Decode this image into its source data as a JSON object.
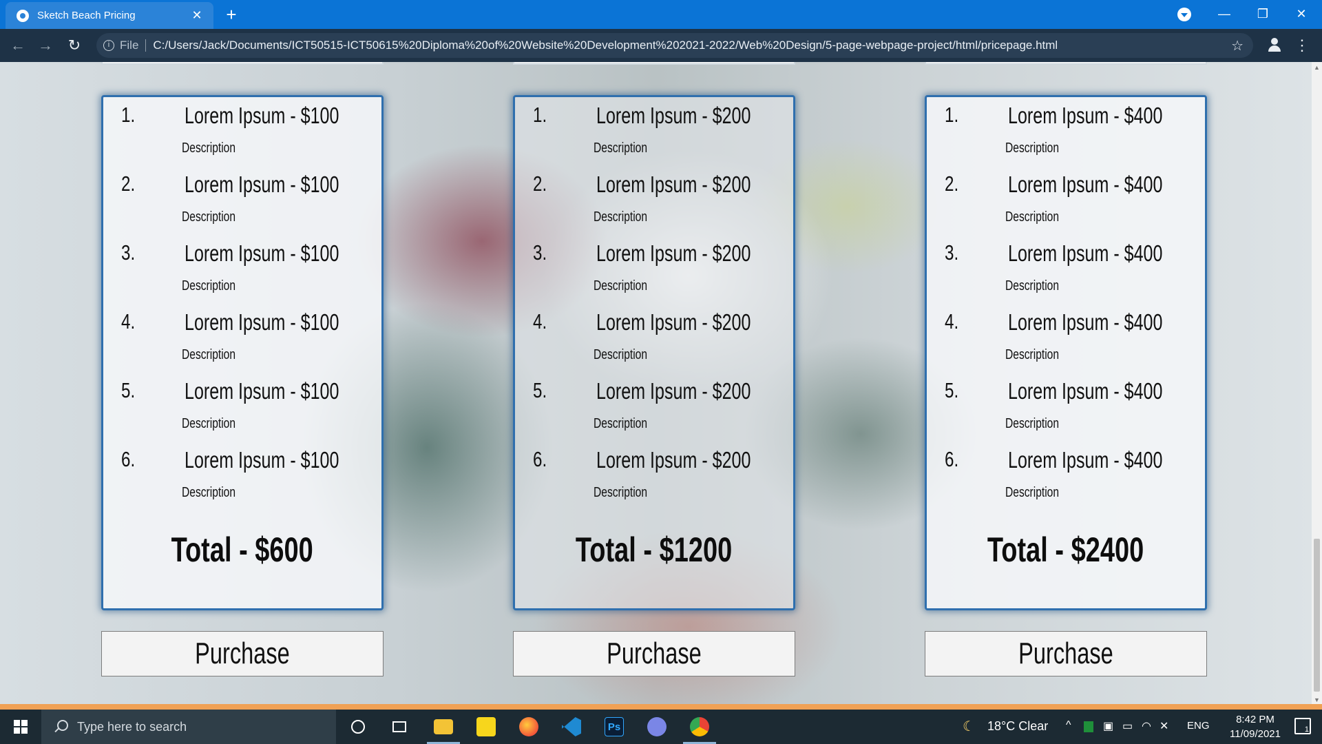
{
  "browser": {
    "tab_title": "Sketch Beach Pricing",
    "tab_close": "✕",
    "new_tab": "+",
    "window": {
      "minimize": "—",
      "maximize": "❐",
      "close": "✕"
    },
    "nav": {
      "back": "←",
      "forward": "→",
      "reload": "↻"
    },
    "address": {
      "info": "i",
      "scheme": "File",
      "url": "C:/Users/Jack/Documents/ICT50515-ICT50615%20Diploma%20of%20Website%20Development%202021-2022/Web%20Design/5-page-webpage-project/html/pricepage.html",
      "star": "☆"
    },
    "menu": "⋮"
  },
  "pricing": {
    "cards": [
      {
        "items": [
          {
            "num": "1.",
            "title": "Lorem Ipsum - $100",
            "desc": "Description"
          },
          {
            "num": "2.",
            "title": "Lorem Ipsum - $100",
            "desc": "Description"
          },
          {
            "num": "3.",
            "title": "Lorem Ipsum - $100",
            "desc": "Description"
          },
          {
            "num": "4.",
            "title": "Lorem Ipsum - $100",
            "desc": "Description"
          },
          {
            "num": "5.",
            "title": "Lorem Ipsum - $100",
            "desc": "Description"
          },
          {
            "num": "6.",
            "title": "Lorem Ipsum - $100",
            "desc": "Description"
          }
        ],
        "total": "Total - $600",
        "button": "Purchase"
      },
      {
        "items": [
          {
            "num": "1.",
            "title": "Lorem Ipsum - $200",
            "desc": "Description"
          },
          {
            "num": "2.",
            "title": "Lorem Ipsum - $200",
            "desc": "Description"
          },
          {
            "num": "3.",
            "title": "Lorem Ipsum - $200",
            "desc": "Description"
          },
          {
            "num": "4.",
            "title": "Lorem Ipsum - $200",
            "desc": "Description"
          },
          {
            "num": "5.",
            "title": "Lorem Ipsum - $200",
            "desc": "Description"
          },
          {
            "num": "6.",
            "title": "Lorem Ipsum - $200",
            "desc": "Description"
          }
        ],
        "total": "Total - $1200",
        "button": "Purchase"
      },
      {
        "items": [
          {
            "num": "1.",
            "title": "Lorem Ipsum - $400",
            "desc": "Description"
          },
          {
            "num": "2.",
            "title": "Lorem Ipsum - $400",
            "desc": "Description"
          },
          {
            "num": "3.",
            "title": "Lorem Ipsum - $400",
            "desc": "Description"
          },
          {
            "num": "4.",
            "title": "Lorem Ipsum - $400",
            "desc": "Description"
          },
          {
            "num": "5.",
            "title": "Lorem Ipsum - $400",
            "desc": "Description"
          },
          {
            "num": "6.",
            "title": "Lorem Ipsum - $400",
            "desc": "Description"
          }
        ],
        "total": "Total - $2400",
        "button": "Purchase"
      }
    ]
  },
  "scrollbar": {
    "up": "▲",
    "down": "▼"
  },
  "taskbar": {
    "search_placeholder": "Type here to search",
    "apps": [
      "cortana-icon",
      "task-view-icon",
      "file-explorer-icon",
      "sticky-notes-icon",
      "firefox-icon",
      "vscode-icon",
      "photoshop-icon",
      "discord-icon",
      "chrome-icon"
    ],
    "photoshop_label": "Ps",
    "weather": "18°C  Clear",
    "lang": "ENG",
    "time": "8:42 PM",
    "date": "11/09/2021",
    "notifications": "1"
  },
  "colors": {
    "titlebar": "#0b74d6",
    "toolbar": "#1e3246",
    "card_border": "#2f6fae",
    "page_bottom_strip": "#f0a155",
    "taskbar": "#1c2a33"
  }
}
